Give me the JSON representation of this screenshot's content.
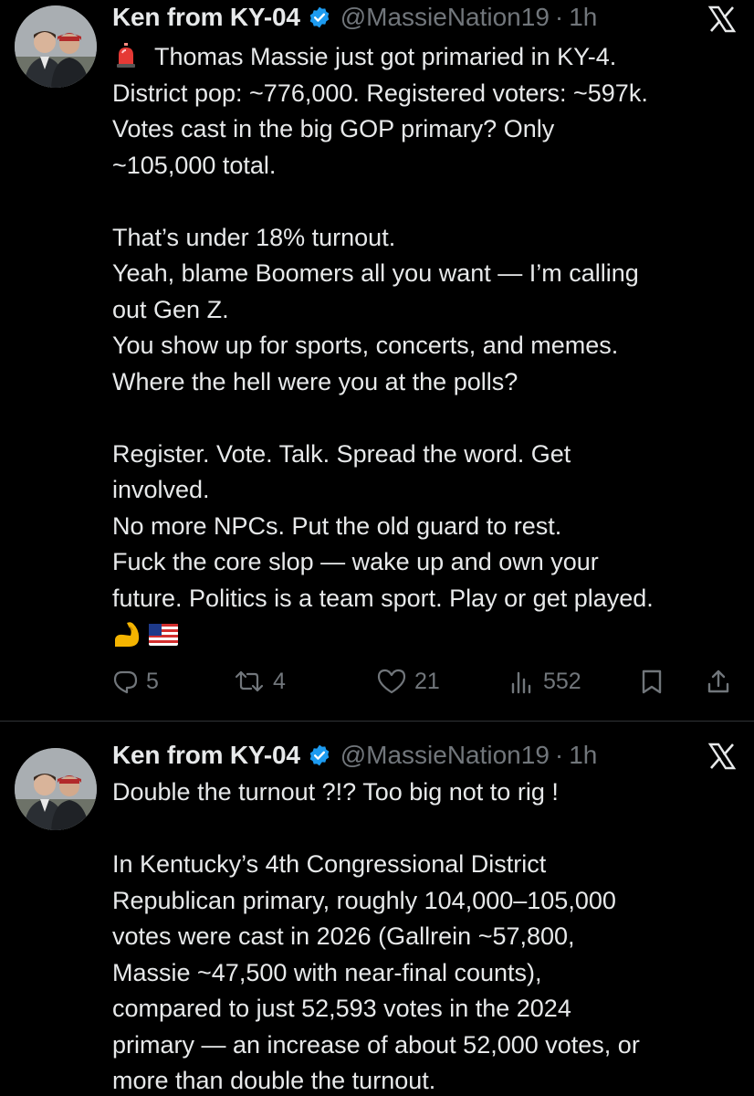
{
  "tweets": [
    {
      "author": {
        "name": "Ken from KY-04",
        "handle": "@MassieNation19",
        "time": "1h",
        "separator": "·",
        "avatar": "avatar-photo-two-men",
        "verified_icon": "verified-badge-icon"
      },
      "text_lines": [
        "Thomas Massie just got primaried in KY-4.",
        "District pop: ~776,000. Registered voters: ~597k.",
        "Votes cast in the big GOP primary? Only",
        "~105,000 total.",
        "",
        "That’s under 18% turnout.",
        "Yeah, blame Boomers all you want — I’m calling",
        "out Gen Z.",
        "You show up for sports, concerts, and memes.",
        "Where the hell were you at the polls?",
        "",
        "Register. Vote. Talk. Spread the word. Get",
        "involved.",
        "No more NPCs. Put the old guard to rest.",
        "Fuck the core slop — wake up and own your",
        "future. Politics is a team sport. Play or get played."
      ],
      "leading_emoji": "siren-emoji",
      "trailing_emoji": [
        "flexed-biceps-emoji",
        "us-flag-emoji"
      ],
      "metrics": {
        "replies": "5",
        "reposts": "4",
        "likes": "21",
        "views": "552"
      }
    },
    {
      "author": {
        "name": "Ken from KY-04",
        "handle": "@MassieNation19",
        "time": "1h",
        "separator": "·",
        "avatar": "avatar-photo-two-men",
        "verified_icon": "verified-badge-icon"
      },
      "text_lines": [
        "Double the turnout ?!?  Too big not to rig !",
        "",
        "In Kentucky’s 4th Congressional District",
        "Republican primary, roughly 104,000–105,000",
        "votes were cast in 2026 (Gallrein ~57,800,",
        "Massie ~47,500 with near-final counts),",
        "compared to just 52,593 votes in the 2024",
        "primary — an increase of about 52,000 votes, or",
        "more than double the turnout."
      ]
    }
  ],
  "icons": {
    "brand": "x-logo-icon",
    "reply": "reply-icon",
    "repost": "repost-icon",
    "like": "heart-icon",
    "views": "views-icon",
    "bookmark": "bookmark-icon",
    "share": "share-icon"
  },
  "colors": {
    "background": "#000000",
    "text": "#e7e9ea",
    "muted": "#71767b",
    "verified": "#1d9bf0",
    "divider": "#2f3336"
  }
}
